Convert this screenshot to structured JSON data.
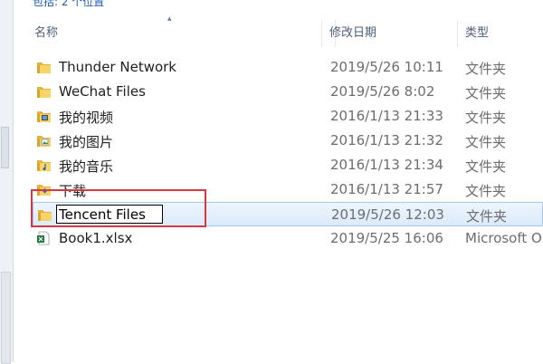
{
  "status": {
    "location_text": "包括: 2 个位置"
  },
  "columns": {
    "name": "名称",
    "date_modified": "修改日期",
    "type": "类型"
  },
  "files": [
    {
      "name": "Thunder Network",
      "date": "2019/5/26 10:11",
      "type": "文件夹",
      "icon": "folder-icon"
    },
    {
      "name": "WeChat Files",
      "date": "2019/5/26 8:02",
      "type": "文件夹",
      "icon": "folder-icon"
    },
    {
      "name": "我的视频",
      "date": "2016/1/13 21:33",
      "type": "文件夹",
      "icon": "video-folder-icon"
    },
    {
      "name": "我的图片",
      "date": "2016/1/13 21:32",
      "type": "文件夹",
      "icon": "pictures-folder-icon"
    },
    {
      "name": "我的音乐",
      "date": "2016/1/13 21:34",
      "type": "文件夹",
      "icon": "music-folder-icon"
    },
    {
      "name": "下载",
      "date": "2016/1/13 21:57",
      "type": "文件夹",
      "icon": "downloads-folder-icon"
    },
    {
      "name": "Tencent Files",
      "date": "2019/5/26 12:03",
      "type": "文件夹",
      "icon": "folder-icon",
      "renaming": true
    },
    {
      "name": "Book1.xlsx",
      "date": "2019/5/25 16:06",
      "type": "Microsoft O",
      "icon": "excel-file-icon"
    }
  ],
  "colors": {
    "selection": "#dbeafb",
    "annotation_box": "#d33a44",
    "folder": "#f2c94c"
  }
}
